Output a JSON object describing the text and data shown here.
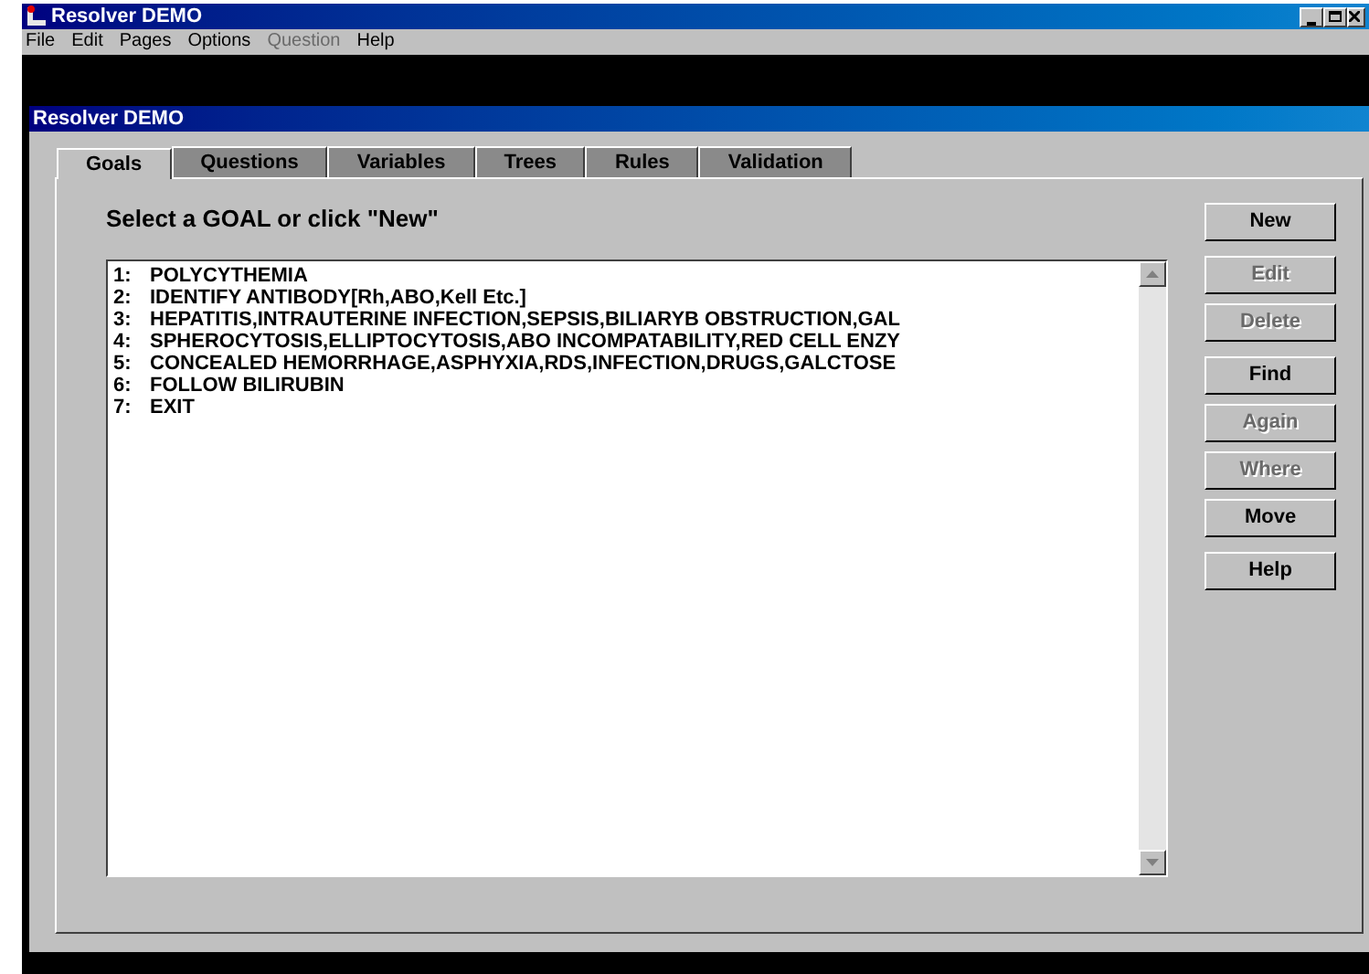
{
  "window": {
    "title": "Resolver DEMO"
  },
  "menu": [
    {
      "label": "File",
      "disabled": false
    },
    {
      "label": "Edit",
      "disabled": false
    },
    {
      "label": "Pages",
      "disabled": false
    },
    {
      "label": "Options",
      "disabled": false
    },
    {
      "label": "Question",
      "disabled": true
    },
    {
      "label": "Help",
      "disabled": false
    }
  ],
  "child_window": {
    "title": "Resolver DEMO"
  },
  "tabs": [
    {
      "label": "Goals",
      "selected": true
    },
    {
      "label": "Questions",
      "selected": false
    },
    {
      "label": "Variables",
      "selected": false
    },
    {
      "label": "Trees",
      "selected": false
    },
    {
      "label": "Rules",
      "selected": false
    },
    {
      "label": "Validation",
      "selected": false
    }
  ],
  "heading": "Select a GOAL or click \"New\"",
  "goals": [
    {
      "number": "1:",
      "text": "POLYCYTHEMIA"
    },
    {
      "number": "2:",
      "text": "IDENTIFY ANTIBODY[Rh,ABO,Kell Etc.]"
    },
    {
      "number": "3:",
      "text": "HEPATITIS,INTRAUTERINE INFECTION,SEPSIS,BILIARYB OBSTRUCTION,GAL"
    },
    {
      "number": "4:",
      "text": "SPHEROCYTOSIS,ELLIPTOCYTOSIS,ABO INCOMPATABILITY,RED CELL ENZY"
    },
    {
      "number": "5:",
      "text": "CONCEALED HEMORRHAGE,ASPHYXIA,RDS,INFECTION,DRUGS,GALCTOSE"
    },
    {
      "number": "6:",
      "text": "FOLLOW BILIRUBIN"
    },
    {
      "number": "7:",
      "text": "EXIT"
    }
  ],
  "button_groups": [
    [
      {
        "label": "New",
        "disabled": false
      }
    ],
    [
      {
        "label": "Edit",
        "disabled": true
      },
      {
        "label": "Delete",
        "disabled": true
      }
    ],
    [
      {
        "label": "Find",
        "disabled": false
      },
      {
        "label": "Again",
        "disabled": true
      },
      {
        "label": "Where",
        "disabled": true
      },
      {
        "label": "Move",
        "disabled": false
      }
    ],
    [
      {
        "label": "Help",
        "disabled": false
      }
    ]
  ]
}
